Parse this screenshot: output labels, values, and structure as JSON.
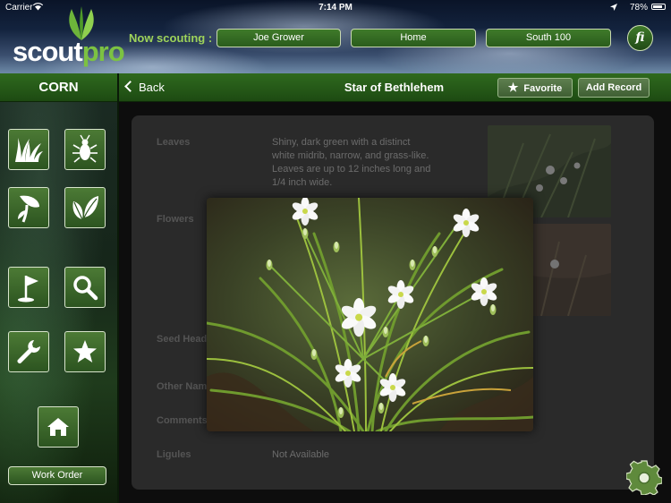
{
  "status_bar": {
    "carrier": "Carrier",
    "time": "7:14 PM",
    "battery": "78%"
  },
  "header": {
    "logo_scout": "scout",
    "logo_pro": "pro",
    "now_scouting_label": "Now scouting :",
    "grower": "Joe Grower",
    "farm": "Home",
    "field": "South 100",
    "fi_label": "fi"
  },
  "crop": "CORN",
  "nav": {
    "back_label": "Back",
    "title": "Star of Bethlehem",
    "favorite_label": "Favorite",
    "add_record_label": "Add Record"
  },
  "sidebar": {
    "buttons": [
      {
        "name": "weeds",
        "icon": "grass-icon"
      },
      {
        "name": "insects",
        "icon": "bug-icon"
      },
      {
        "name": "diseases",
        "icon": "leaf-disease-icon"
      },
      {
        "name": "nutrients",
        "icon": "leaves-icon"
      },
      {
        "name": "field-flag",
        "icon": "flag-icon"
      },
      {
        "name": "search",
        "icon": "search-icon"
      },
      {
        "name": "tools",
        "icon": "wrench-icon"
      },
      {
        "name": "favorites",
        "icon": "star-icon"
      },
      {
        "name": "home",
        "icon": "home-icon"
      }
    ],
    "work_order_label": "Work Order"
  },
  "detail": {
    "leaves_label": "Leaves",
    "leaves_value": "Shiny, dark green with a distinct white midrib, narrow, and grass-like. Leaves are up to 12 inches long and 1/4 inch wide.",
    "flowers_label": "Flowers",
    "seed_head_label": "Seed Head",
    "other_names_label": "Other Names",
    "comments_label": "Comments",
    "ligules_label": "Ligules",
    "ligules_value": "Not Available"
  },
  "colors": {
    "accent_green": "#7cc242",
    "bar_green": "#2f6a1e",
    "label_green": "#9ed35a"
  }
}
